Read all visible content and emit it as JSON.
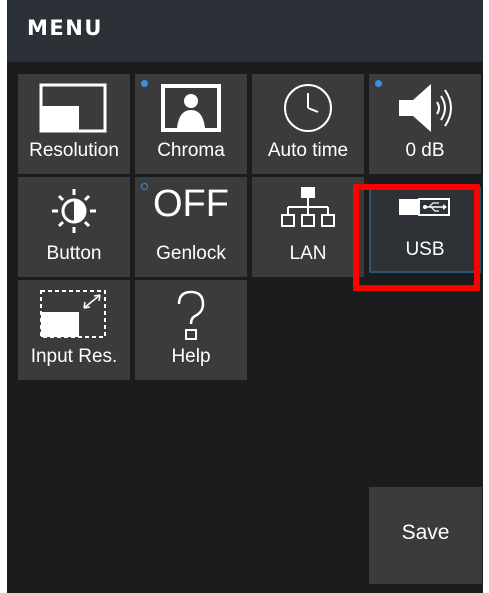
{
  "header": {
    "title": "MENU"
  },
  "tiles": [
    {
      "label": "Resolution",
      "icon": "resolution-icon"
    },
    {
      "label": "Chroma",
      "icon": "chroma-person-icon",
      "indicator": "filled"
    },
    {
      "label": "Auto time",
      "icon": "clock-icon"
    },
    {
      "label": "0 dB",
      "icon": "speaker-volume-icon",
      "indicator": "filled"
    },
    {
      "label": "Button",
      "icon": "brightness-icon"
    },
    {
      "label": "Genlock",
      "value": "OFF",
      "indicator": "hollow"
    },
    {
      "label": "LAN",
      "icon": "network-icon"
    },
    {
      "label": "USB",
      "icon": "usb-icon",
      "selected": true
    },
    {
      "label": "Input Res.",
      "icon": "input-resolution-icon"
    },
    {
      "label": "Help",
      "icon": "question-mark-icon"
    }
  ],
  "actions": {
    "save_label": "Save"
  },
  "colors": {
    "background": "#1b1c1e",
    "header": "#2c3138",
    "tile": "#3a3b3d",
    "indicator": "#3b8fde",
    "highlight": "#ff0000"
  }
}
